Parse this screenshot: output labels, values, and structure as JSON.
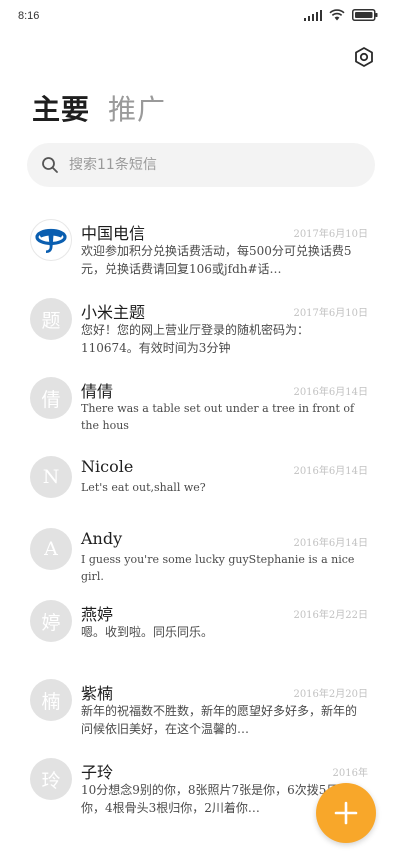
{
  "status_bar": {
    "time": "8:16",
    "icons": [
      "cellular-signal-icon",
      "wifi-icon",
      "battery-icon"
    ]
  },
  "toolbar": {
    "settings_icon": "settings-hexagon-icon"
  },
  "tabs": [
    {
      "label": "主要",
      "active": true
    },
    {
      "label": "推广",
      "active": false
    }
  ],
  "search": {
    "placeholder": "搜索11条短信",
    "value": ""
  },
  "messages": [
    {
      "avatar": "",
      "avatar_type": "china-telecom-logo-icon",
      "name": "中国电信",
      "date": "2017年6月10日",
      "preview": "欢迎参加积分兑换话费活动，每500分可兑换话费5元，兑换话费请回复106或jfdh#话…"
    },
    {
      "avatar": "题",
      "name": "小米主题",
      "date": "2017年6月10日",
      "preview": "您好！您的网上营业厅登录的随机密码为：110674。有效时间为3分钟"
    },
    {
      "avatar": "倩",
      "name": "倩倩",
      "date": "2016年6月14日",
      "preview": "There was a table set out under a tree in front of the hous"
    },
    {
      "avatar": "N",
      "name": "Nicole",
      "date": "2016年6月14日",
      "preview": "Let's eat out,shall we?"
    },
    {
      "avatar": "A",
      "name": "Andy",
      "date": "2016年6月14日",
      "preview": "I guess you're some lucky guyStephanie is a nice girl."
    },
    {
      "avatar": "婷",
      "name": "燕婷",
      "date": "2016年2月22日",
      "preview": "嗯。收到啦。同乐同乐。"
    },
    {
      "avatar": "楠",
      "name": "紫楠",
      "date": "2016年2月20日",
      "preview": "新年的祝福数不胜数，新年的愿望好多好多，新年的问候依旧美好，在这个温馨的…"
    },
    {
      "avatar": "玲",
      "name": "子玲",
      "date": "2016年",
      "preview": "10分想念9别的你，8张照片7张是你，6次拨5只瘊你，4根骨头3根归你，2川着你…"
    }
  ],
  "fab": {
    "label": "+",
    "icon": "plus-icon"
  },
  "colors": {
    "accent": "#f8a72a",
    "avatar_bg": "#e2e2e2",
    "search_bg": "#f3f3f3",
    "brand_blue": "#0a5eb0"
  }
}
